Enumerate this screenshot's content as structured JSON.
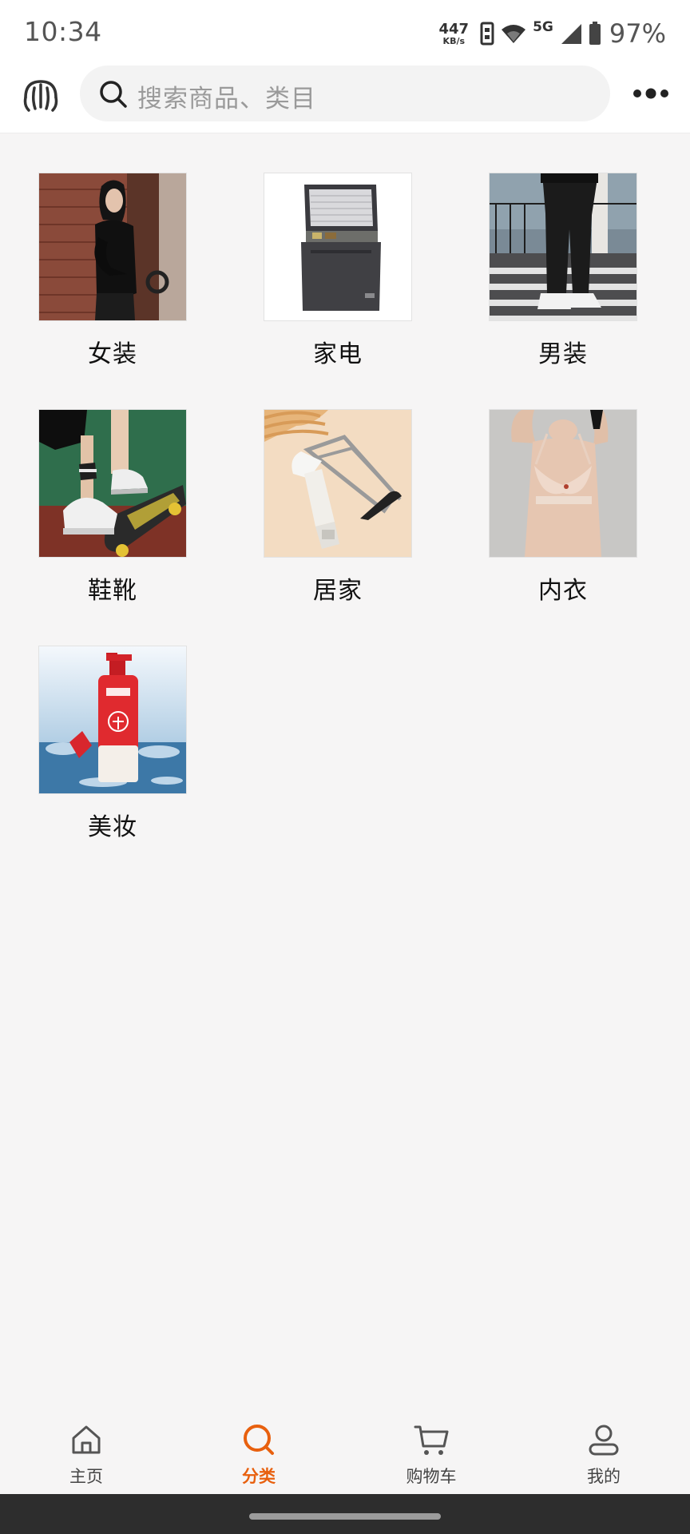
{
  "status": {
    "time": "10:34",
    "net_speed": "447",
    "net_unit": "KB/s",
    "network": "5G",
    "battery": "97%"
  },
  "header": {
    "logo_icon": "jellyfish-logo-icon",
    "search_placeholder": "搜索商品、类目",
    "more_icon": "more-dots-icon"
  },
  "categories": [
    {
      "label": "女装",
      "image": "woman-in-black-leather-jacket"
    },
    {
      "label": "家电",
      "image": "chest-freezer"
    },
    {
      "label": "男装",
      "image": "man-in-black-joggers"
    },
    {
      "label": "鞋靴",
      "image": "white-sneakers-on-skateboard"
    },
    {
      "label": "居家",
      "image": "kitchen-utensils"
    },
    {
      "label": "内衣",
      "image": "beige-bra"
    },
    {
      "label": "美妆",
      "image": "red-shampoo-bottle"
    }
  ],
  "nav": {
    "items": [
      {
        "label": "主页",
        "icon": "home-icon",
        "active": false
      },
      {
        "label": "分类",
        "icon": "search-category-icon",
        "active": true
      },
      {
        "label": "购物车",
        "icon": "cart-icon",
        "active": false
      },
      {
        "label": "我的",
        "icon": "user-icon",
        "active": false
      }
    ]
  },
  "colors": {
    "accent": "#e8600e",
    "background": "#f6f5f5",
    "header": "#ffffff"
  }
}
